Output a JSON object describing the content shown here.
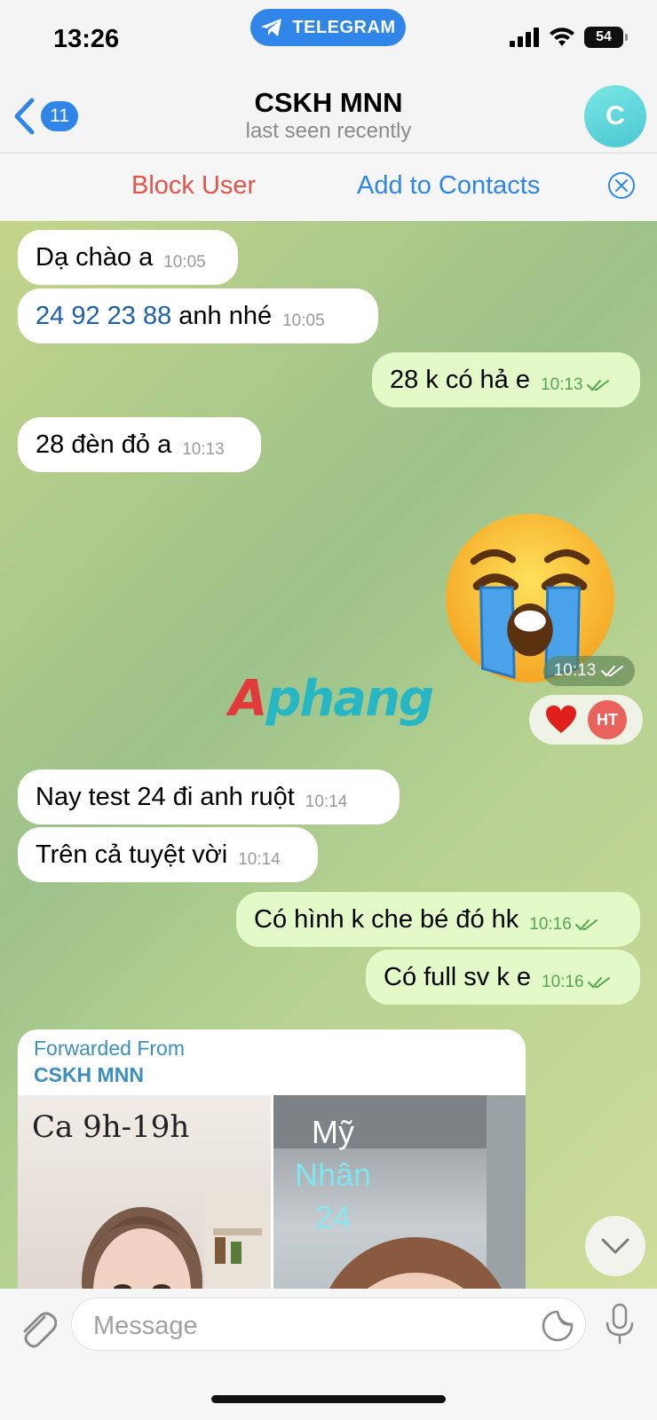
{
  "status_bar": {
    "time": "13:26",
    "app_pill": "TELEGRAM",
    "battery": "54"
  },
  "header": {
    "back_count": "11",
    "title": "CSKH MNN",
    "subtitle": "last seen recently",
    "avatar_letter": "C",
    "avatar_color": "#5bd3d8"
  },
  "actions": {
    "block": "Block User",
    "add": "Add to Contacts"
  },
  "messages": [
    {
      "dir": "in",
      "text": "Dạ chào a",
      "time": "10:05"
    },
    {
      "dir": "in",
      "link": "24 92 23 88",
      "text": " anh nhé",
      "time": "10:05"
    },
    {
      "dir": "out",
      "text": "28 k có hả e",
      "time": "10:13",
      "read": true
    },
    {
      "dir": "in",
      "text": "28 đèn đỏ a",
      "time": "10:13"
    },
    {
      "dir": "out",
      "sticker": "loudly-crying-face",
      "time": "10:13",
      "read": true,
      "reaction": {
        "emoji": "red-heart",
        "user": "HT"
      }
    },
    {
      "dir": "in",
      "text": "Nay test 24 đi anh ruột",
      "time": "10:14"
    },
    {
      "dir": "in",
      "text": "Trên cả tuyệt vời",
      "time": "10:14"
    },
    {
      "dir": "out",
      "text": "Có hình k che bé đó hk",
      "time": "10:16",
      "read": true
    },
    {
      "dir": "out",
      "text": "Có full sv k e",
      "time": "10:16",
      "read": true
    }
  ],
  "forwarded": {
    "label": "Forwarded From",
    "from": "CSKH MNN",
    "photo1_caption": "Ca 9h-19h",
    "photo2_caption": [
      "Mỹ",
      "Nhân",
      "24"
    ]
  },
  "watermark": {
    "part1": "A",
    "part2": "phang"
  },
  "input": {
    "placeholder": "Message"
  },
  "colors": {
    "accent": "#2f86e8",
    "danger": "#e5534b",
    "outgoing": "#e3f9c8",
    "check": "#54a64f"
  }
}
